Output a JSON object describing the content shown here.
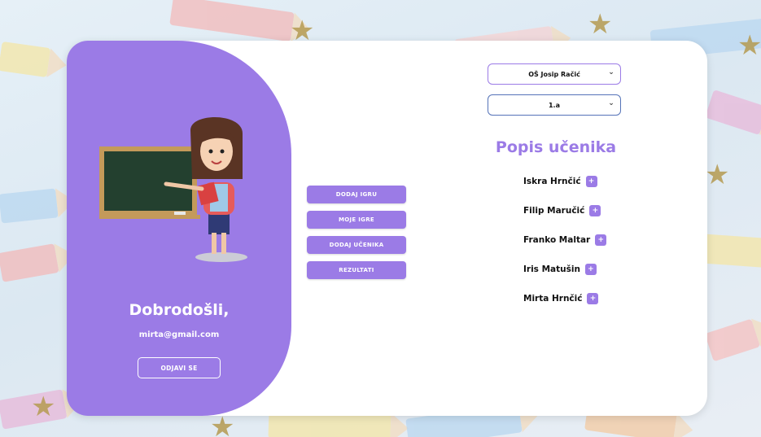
{
  "colors": {
    "accent": "#9b7be6",
    "card": "#ffffff",
    "text": "#111111"
  },
  "welcome": {
    "greeting": "Dobrodošli,",
    "email": "mirta@gmail.com",
    "logout_label": "ODJAVI SE"
  },
  "menu": {
    "items": [
      {
        "label": "DODAJ IGRU"
      },
      {
        "label": "MOJE IGRE"
      },
      {
        "label": "DODAJ UČENIKA"
      },
      {
        "label": "REZULTATI"
      }
    ]
  },
  "filters": {
    "school": {
      "value": "OŠ Josip Račić",
      "icon": "chevron-down-icon"
    },
    "class": {
      "value": "1.a",
      "icon": "chevron-down-icon"
    }
  },
  "students": {
    "title": "Popis učenika",
    "add_icon": "plus-icon",
    "items": [
      {
        "name": "Iskra Hrnčić"
      },
      {
        "name": "Filip Maručić"
      },
      {
        "name": "Franko Maltar"
      },
      {
        "name": "Iris Matušin"
      },
      {
        "name": "Mirta Hrnčić"
      }
    ]
  }
}
